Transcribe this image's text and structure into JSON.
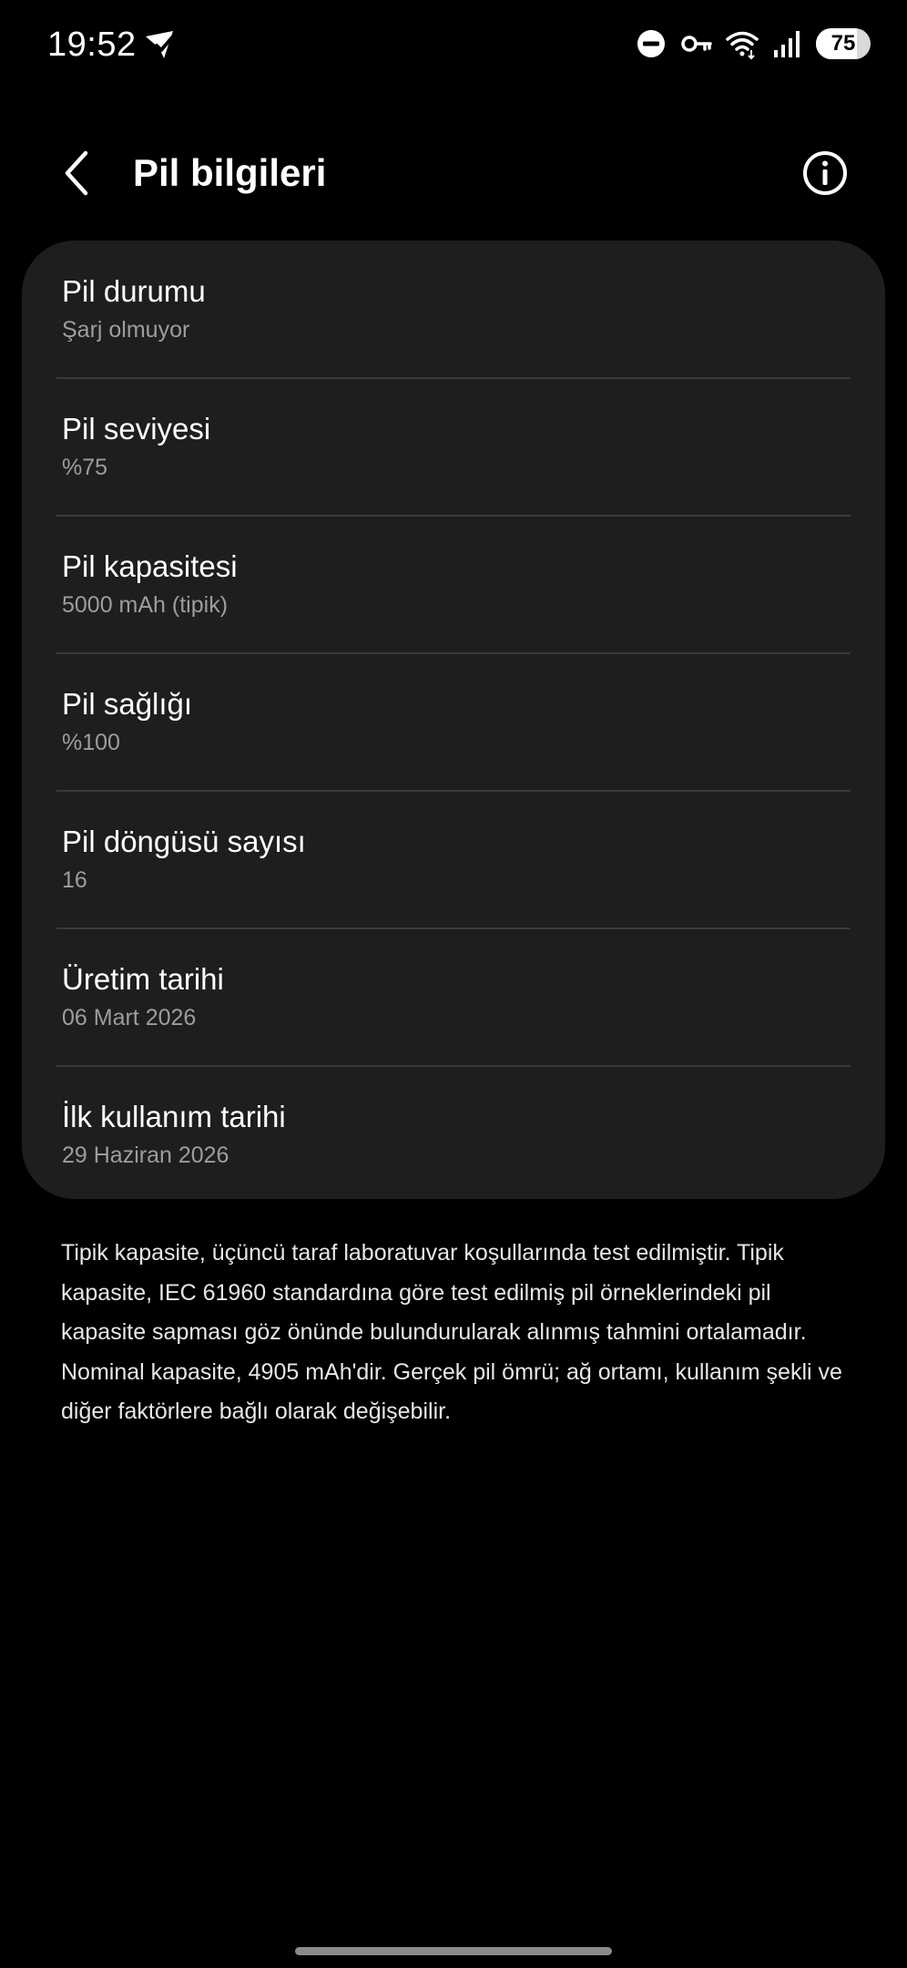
{
  "status_bar": {
    "time": "19:52",
    "battery_level": 75,
    "battery_text": "75",
    "icons": [
      "location-check-icon",
      "do-not-disturb-icon",
      "vpn-key-icon",
      "wifi-icon",
      "cellular-signal-icon",
      "battery-icon"
    ]
  },
  "header": {
    "title": "Pil bilgileri",
    "back_icon": "back-arrow-icon",
    "info_icon": "info-icon"
  },
  "items": [
    {
      "label": "Pil durumu",
      "value": "Şarj olmuyor"
    },
    {
      "label": "Pil seviyesi",
      "value": "%75"
    },
    {
      "label": "Pil kapasitesi",
      "value": "5000 mAh (tipik)"
    },
    {
      "label": "Pil sağlığı",
      "value": "%100"
    },
    {
      "label": "Pil döngüsü sayısı",
      "value": "16"
    },
    {
      "label": "Üretim tarihi",
      "value": "06 Mart 2026"
    },
    {
      "label": "İlk kullanım tarihi",
      "value": "29 Haziran 2026"
    }
  ],
  "footnote": "Tipik kapasite, üçüncü taraf laboratuvar koşullarında test edilmiştir. Tipik kapasite, IEC 61960 standardına göre test edilmiş pil örneklerindeki pil kapasite sapması göz önünde bulundurularak alınmış tahmini ortalamadır. Nominal kapasite, 4905 mAh'dir. Gerçek pil ömrü; ağ ortamı, kullanım şekli ve diğer faktörlere bağlı olarak değişebilir.",
  "colors": {
    "background": "#000000",
    "card": "#1e1e1e",
    "primary_text": "#ffffff",
    "secondary_text": "#9d9d9d",
    "divider": "#3a3a3a"
  }
}
